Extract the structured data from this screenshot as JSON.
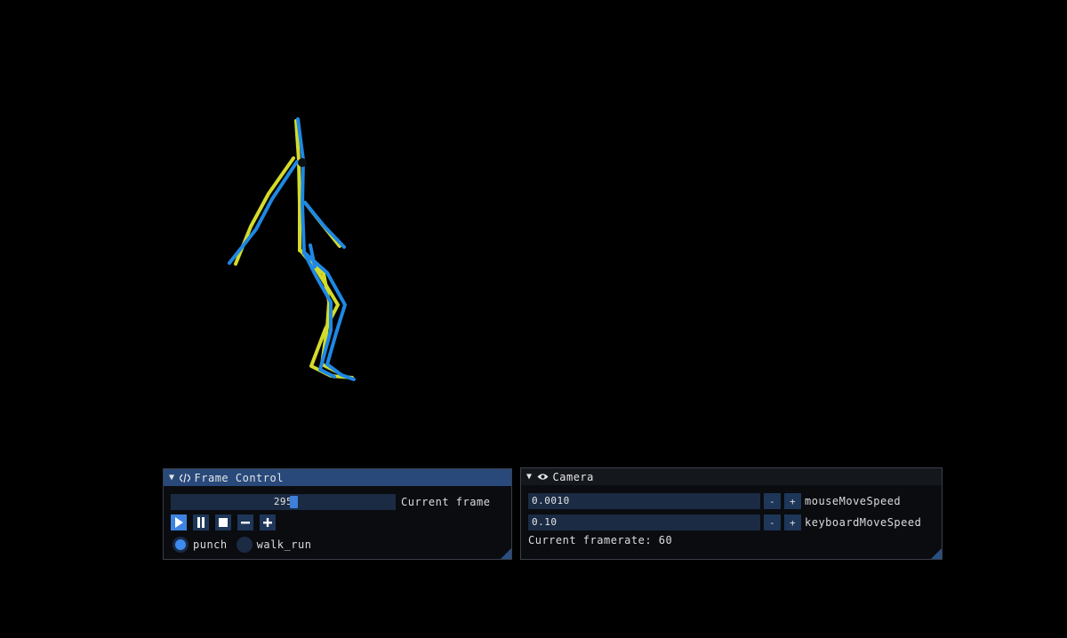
{
  "frame_control": {
    "title": "Frame Control",
    "frame_value": "295",
    "frame_label": "Current frame",
    "frame_progress": 0.55,
    "buttons": [
      "play-icon",
      "pause-icon",
      "stop-icon",
      "minus-icon",
      "plus-icon"
    ],
    "animations": [
      {
        "label": "punch",
        "selected": true
      },
      {
        "label": "walk_run",
        "selected": false
      }
    ]
  },
  "camera": {
    "title": "Camera",
    "mouse_speed_value": "0.0010",
    "mouse_speed_label": "mouseMoveSpeed",
    "keyboard_speed_value": "0.10",
    "keyboard_speed_label": "keyboardMoveSpeed",
    "step_minus": "-",
    "step_plus": "+",
    "framerate_text": "Current framerate: 60"
  },
  "colors": {
    "skeleton_a": "#1e88e5",
    "skeleton_b": "#d4dc2a",
    "header_active": "#28497a",
    "accent": "#3d84e0"
  }
}
